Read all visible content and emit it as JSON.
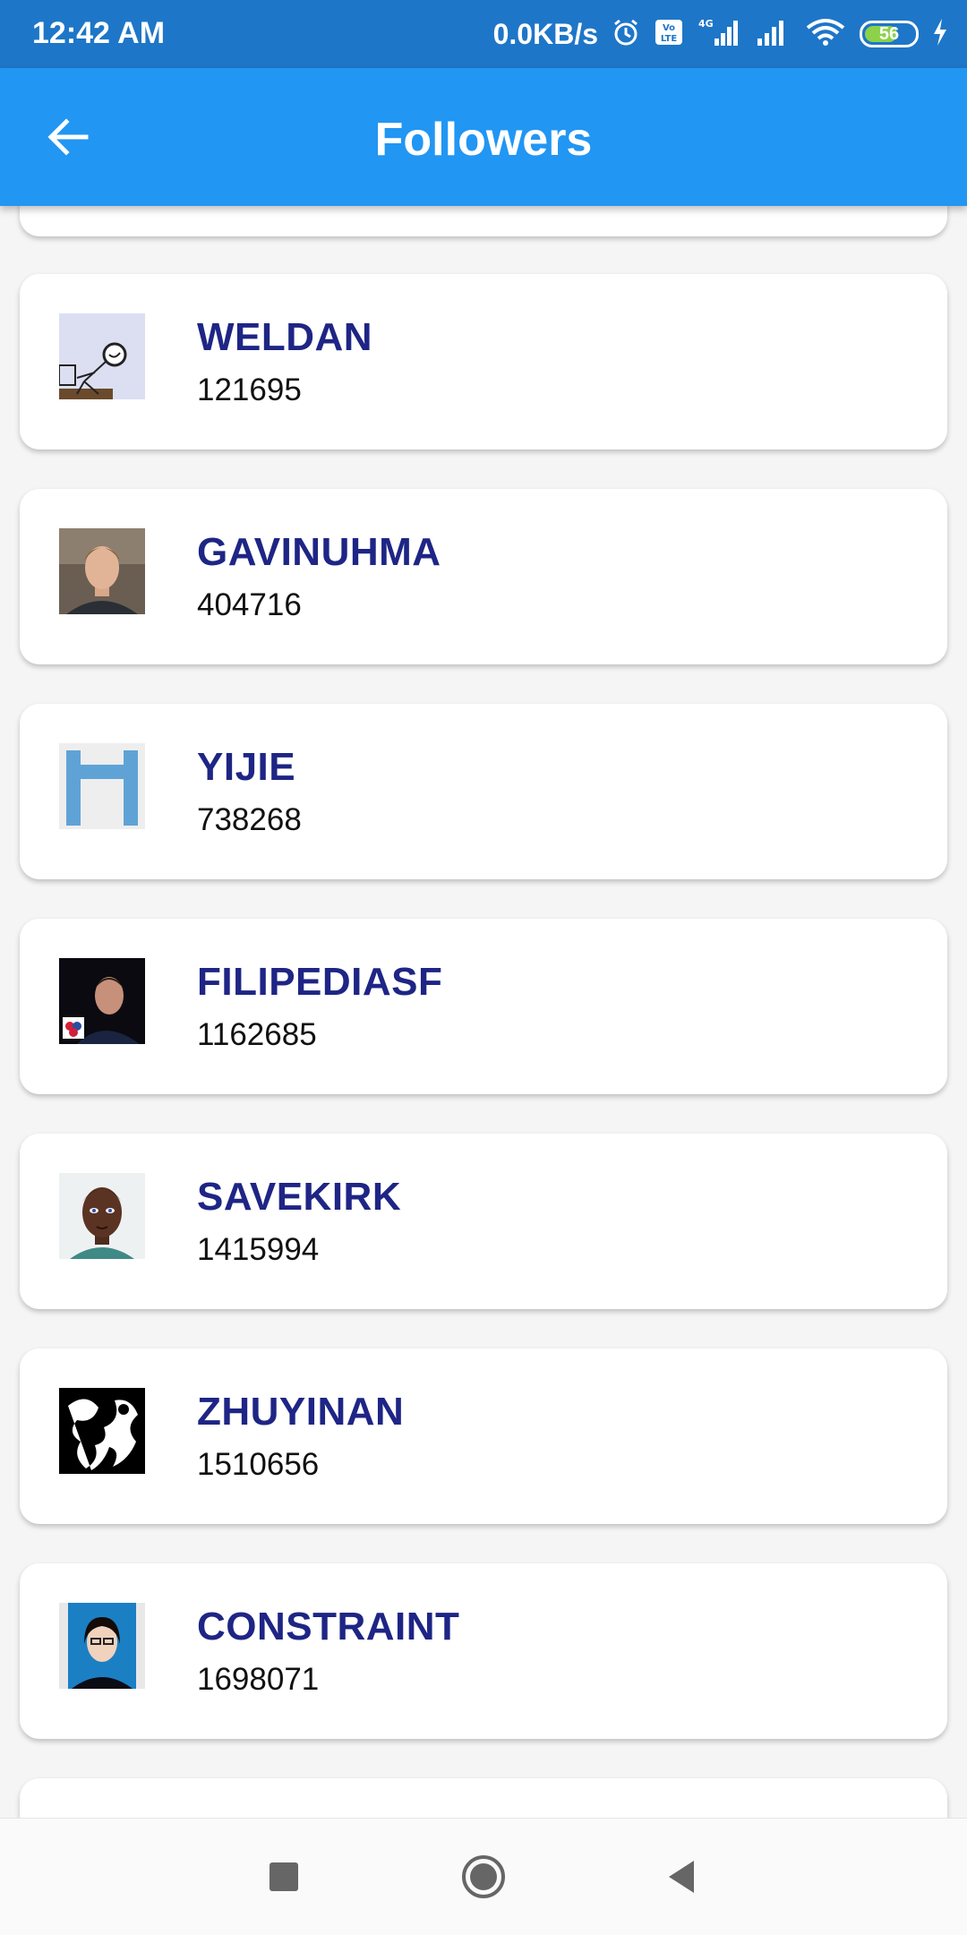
{
  "status_bar": {
    "time": "12:42 AM",
    "net_speed": "0.0KB/s",
    "battery_level": "56",
    "icons": [
      "alarm-icon",
      "volte-icon",
      "4g-signal-icon",
      "signal-icon",
      "wifi-icon",
      "battery-icon",
      "charging-icon"
    ]
  },
  "app_bar": {
    "title": "Followers",
    "back_icon": "arrow-left-icon"
  },
  "followers": [
    {
      "name": "WELDAN",
      "count": "121695"
    },
    {
      "name": "GAVINUHMA",
      "count": "404716"
    },
    {
      "name": "YIJIE",
      "count": "738268"
    },
    {
      "name": "FILIPEDIASF",
      "count": "1162685"
    },
    {
      "name": "SAVEKIRK",
      "count": "1415994"
    },
    {
      "name": "ZHUYINAN",
      "count": "1510656"
    },
    {
      "name": "CONSTRAINT",
      "count": "1698071"
    }
  ],
  "nav_bar": {
    "icons": [
      "recents-square-icon",
      "home-circle-icon",
      "back-triangle-icon"
    ]
  },
  "colors": {
    "status_bar": "#1e76c8",
    "app_bar": "#2196f3",
    "name_text": "#1e2585",
    "background": "#f5f5f5"
  }
}
